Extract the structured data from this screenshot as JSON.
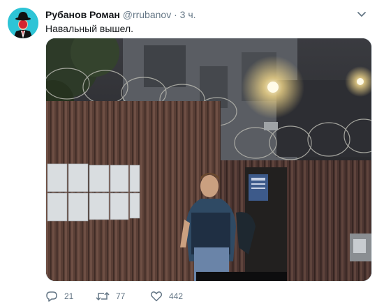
{
  "tweet": {
    "author_name": "Рубанов Роман",
    "author_handle": "@rrubanov",
    "separator": "·",
    "time": "3 ч.",
    "text": "Навальный вышел.",
    "replies": "21",
    "retweets": "77",
    "likes": "442"
  },
  "icons": {
    "avatar": "bowler-hat-man-avatar",
    "menu": "chevron-down-icon",
    "reply": "reply-icon",
    "retweet": "retweet-icon",
    "like": "heart-icon"
  },
  "colors": {
    "avatar_bg": "#2ec4d6",
    "secondary_text": "#657786",
    "primary_text": "#14171a"
  }
}
